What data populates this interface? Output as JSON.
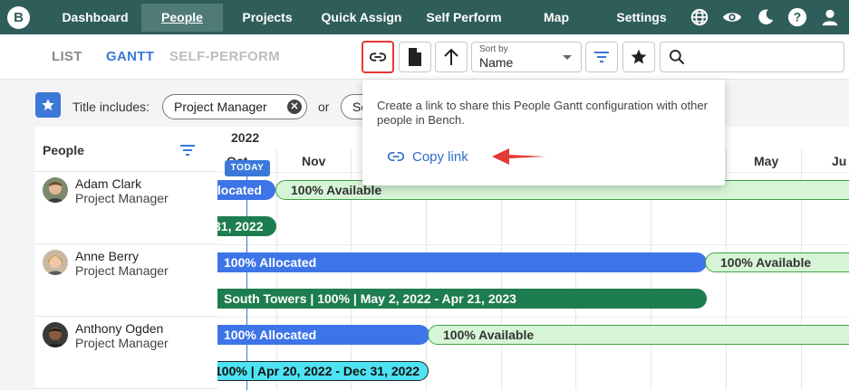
{
  "nav": {
    "logo": "B",
    "items": [
      {
        "label": "Dashboard"
      },
      {
        "label": "People"
      },
      {
        "label": "Projects"
      },
      {
        "label": "Quick Assign"
      },
      {
        "label": "Self Perform"
      },
      {
        "label": "Map"
      },
      {
        "label": "Settings"
      }
    ],
    "icons": [
      "globe-icon",
      "eye-icon",
      "moon-icon",
      "help-icon",
      "user-icon"
    ]
  },
  "view_tabs": [
    {
      "label": "LIST"
    },
    {
      "label": "GANTT"
    },
    {
      "label": "SELF-PERFORM"
    }
  ],
  "toolbar": {
    "sort_caption": "Sort by",
    "sort_value": "Name",
    "search_placeholder": ""
  },
  "filter": {
    "title_label": "Title includes:",
    "chips": [
      {
        "label": "Project Manager"
      },
      {
        "label": "Se"
      }
    ],
    "or_text": "or"
  },
  "people_panel": {
    "title": "People",
    "people": [
      {
        "name": "Adam Clark",
        "role": "Project Manager"
      },
      {
        "name": "Anne Berry",
        "role": "Project Manager"
      },
      {
        "name": "Anthony Ogden",
        "role": "Project Manager"
      }
    ]
  },
  "gantt": {
    "year": "2022",
    "months": [
      "Oct",
      "Nov",
      "May",
      "Ju"
    ],
    "today_label": "TODAY",
    "bars": [
      {
        "label": "llocated"
      },
      {
        "label": "100% Available"
      },
      {
        "label": "31, 2022"
      },
      {
        "label": "100% Allocated"
      },
      {
        "label": "100% Available"
      },
      {
        "label": "South Towers | 100% | May 2, 2022 - Apr 21, 2023"
      },
      {
        "label": "100% Allocated"
      },
      {
        "label": "100% Available"
      },
      {
        "label": "100% | Apr 20, 2022 - Dec 31, 2022"
      }
    ]
  },
  "popover": {
    "text": "Create a link to share this People Gantt configuration with other people in Bench.",
    "copy_link": "Copy link"
  },
  "colors": {
    "nav_bg": "#2f5d5a",
    "accent": "#3b78d8",
    "allocated": "#3d75e8",
    "available": "#d6f5d6",
    "project": "#1e7d4f",
    "highlight": "#e53935"
  }
}
